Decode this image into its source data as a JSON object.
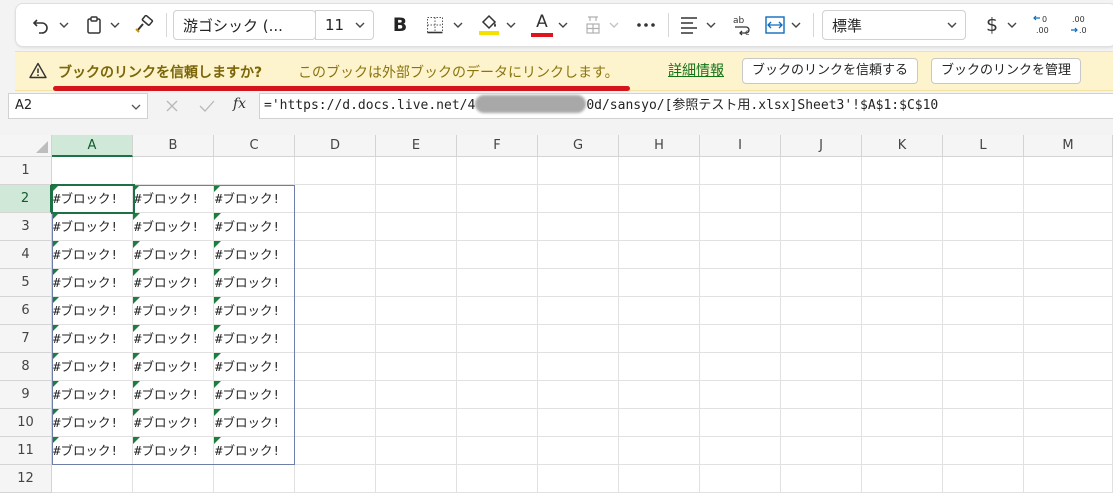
{
  "ribbon": {
    "font_name": "游ゴシック (...",
    "font_size": "11",
    "bold_label": "B",
    "font_color_label": "A",
    "number_format": "標準",
    "currency_symbol": "$",
    "accent_color": "#1e7145"
  },
  "message_bar": {
    "title": "ブックのリンクを信頼しますか?",
    "text": "このブックは外部ブックのデータにリンクします。",
    "details_link": "詳細情報",
    "trust_button": "ブックのリンクを信頼する",
    "manage_button": "ブックのリンクを管理"
  },
  "formula_bar": {
    "name_box": "A2",
    "fx_label": "fx",
    "formula_before": "='https://d.docs.live.net/4",
    "formula_after": "0d/sansyo/[参照テスト用.xlsx]Sheet3'!$A$1:$C$10"
  },
  "grid": {
    "columns": [
      "A",
      "B",
      "C",
      "D",
      "E",
      "F",
      "G",
      "H",
      "I",
      "J",
      "K",
      "L",
      "M"
    ],
    "rows": [
      "1",
      "2",
      "3",
      "4",
      "5",
      "6",
      "7",
      "8",
      "9",
      "10",
      "11",
      "12"
    ],
    "selected_cell": "A2",
    "cell_value": "#ブロック!"
  }
}
